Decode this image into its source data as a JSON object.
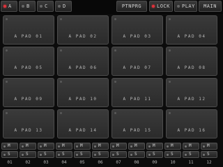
{
  "topbar": {
    "banks": [
      {
        "label": "A",
        "active": true
      },
      {
        "label": "B",
        "active": false
      },
      {
        "label": "C",
        "active": false
      },
      {
        "label": "D",
        "active": false
      }
    ],
    "ptnprg": "PTNPRG",
    "lock": "LOCK",
    "play": "PLAY",
    "main": "MAIN"
  },
  "pads": [
    "A PAD 01",
    "A PAD 02",
    "A PAD 03",
    "A PAD 04",
    "A PAD 05",
    "A PAD 06",
    "A PAD 07",
    "A PAD 08",
    "A PAD 09",
    "A PAD 10",
    "A PAD 11",
    "A PAD 12",
    "A PAD 13",
    "A PAD 14",
    "A PAD 15",
    "A PAD 16"
  ],
  "strips": {
    "mute_label": "M",
    "solo_label": "S",
    "numbers": [
      "01",
      "02",
      "03",
      "04",
      "05",
      "06",
      "07",
      "08",
      "09",
      "10",
      "11",
      "12"
    ]
  },
  "colors": {
    "accent_led": "#e0303a",
    "background": "#0c0c0c",
    "pad": "#333333"
  }
}
